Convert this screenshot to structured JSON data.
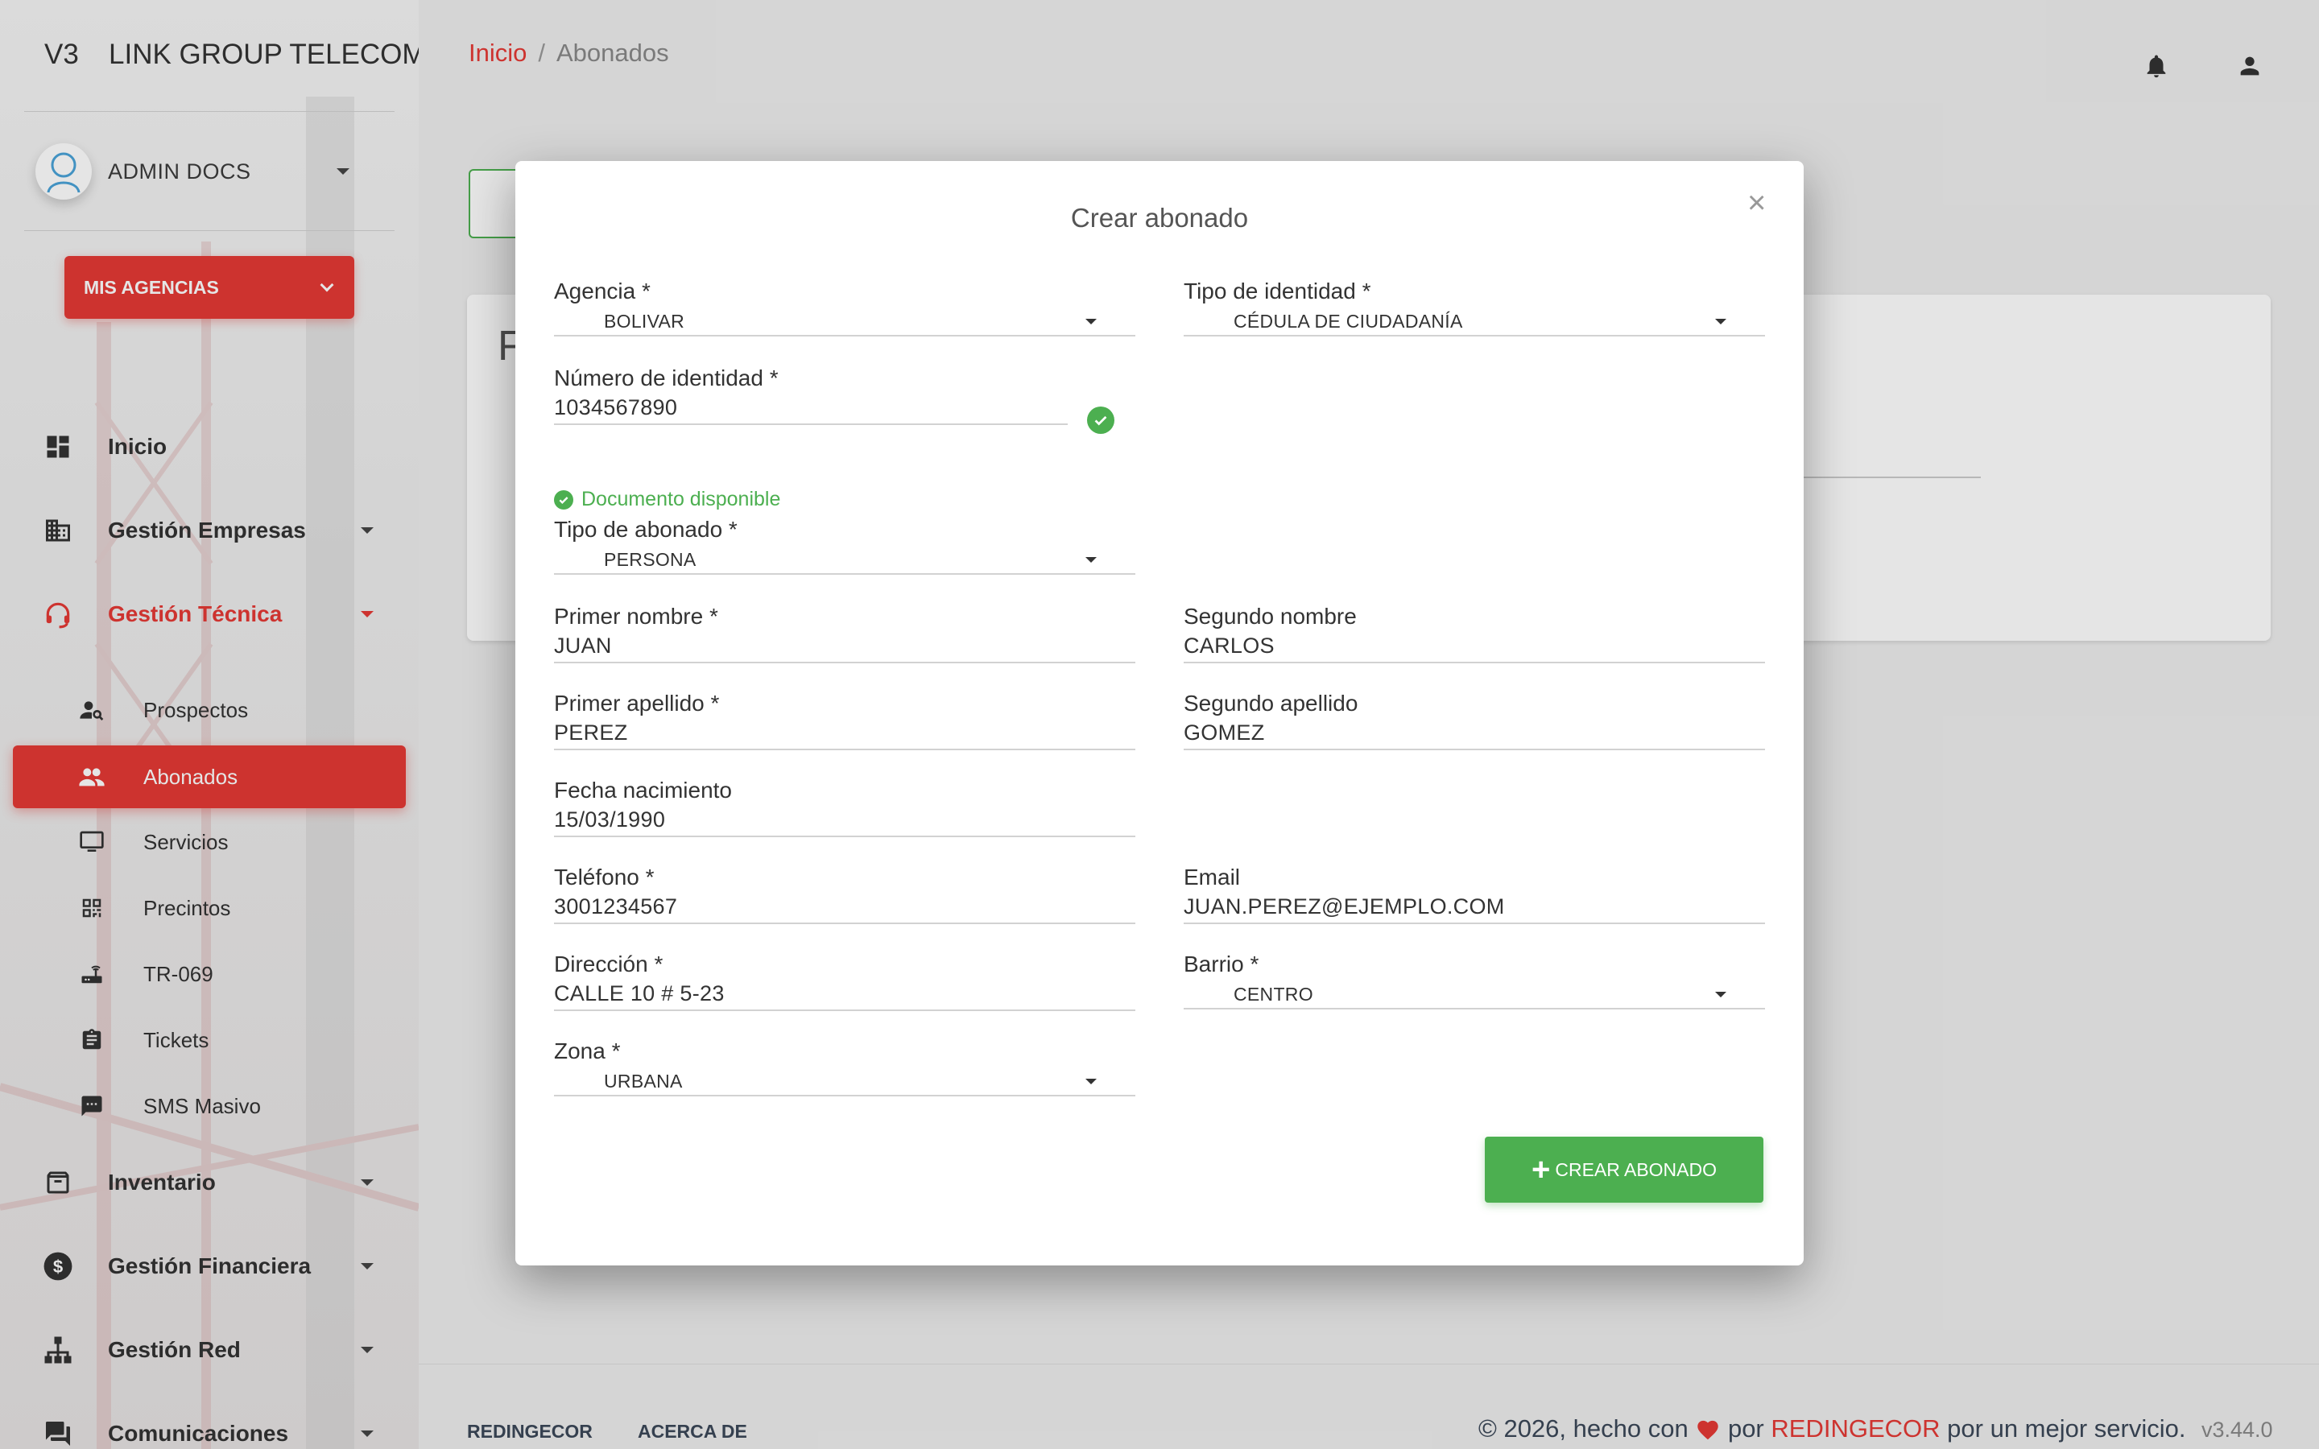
{
  "app": {
    "mini_logo": "V3",
    "title": "LINK GROUP TELECOMUNICACIONES"
  },
  "user": {
    "name": "ADMIN DOCS"
  },
  "agencies_button": {
    "label": "MIS AGENCIAS"
  },
  "sidebar": {
    "items": [
      {
        "label": "Inicio",
        "icon": "dashboard-icon"
      },
      {
        "label": "Gestión Empresas",
        "icon": "building-icon"
      },
      {
        "label": "Gestión Técnica",
        "icon": "support-agent-icon"
      },
      {
        "label": "Inventario",
        "icon": "archive-icon"
      },
      {
        "label": "Gestión Financiera",
        "icon": "dollar-icon"
      },
      {
        "label": "Gestión Red",
        "icon": "network-icon"
      },
      {
        "label": "Comunicaciones",
        "icon": "chat-icon"
      }
    ],
    "subitems": [
      {
        "label": "Prospectos",
        "icon": "person-search-icon"
      },
      {
        "label": "Abonados",
        "icon": "people-icon"
      },
      {
        "label": "Servicios",
        "icon": "monitor-icon"
      },
      {
        "label": "Precintos",
        "icon": "qr-code-icon"
      },
      {
        "label": "TR-069",
        "icon": "router-icon"
      },
      {
        "label": "Tickets",
        "icon": "clipboard-icon"
      },
      {
        "label": "SMS Masivo",
        "icon": "sms-icon"
      }
    ]
  },
  "breadcrumb": {
    "home": "Inicio",
    "sep": "/",
    "current": "Abonados"
  },
  "background": {
    "card_heading": "F"
  },
  "modal": {
    "title": "Crear abonado",
    "close": "×",
    "doc_status": "Documento disponible",
    "submit_label": "CREAR ABONADO",
    "fields": {
      "agencia": {
        "label": "Agencia *",
        "value": "BOLIVAR"
      },
      "tipo_identidad": {
        "label": "Tipo de identidad *",
        "value": "CÉDULA DE CIUDADANÍA"
      },
      "numero_identidad": {
        "label": "Número de identidad *",
        "value": "1034567890"
      },
      "tipo_abonado": {
        "label": "Tipo de abonado *",
        "value": "PERSONA"
      },
      "primer_nombre": {
        "label": "Primer nombre *",
        "value": "JUAN"
      },
      "segundo_nombre": {
        "label": "Segundo nombre",
        "value": "CARLOS"
      },
      "primer_apellido": {
        "label": "Primer apellido *",
        "value": "PEREZ"
      },
      "segundo_apellido": {
        "label": "Segundo apellido",
        "value": "GOMEZ"
      },
      "fecha_nacimiento": {
        "label": "Fecha nacimiento",
        "value": "15/03/1990"
      },
      "telefono": {
        "label": "Teléfono *",
        "value": "3001234567"
      },
      "email": {
        "label": "Email",
        "value": "JUAN.PEREZ@EJEMPLO.COM"
      },
      "direccion": {
        "label": "Dirección *",
        "value": "CALLE 10 # 5-23"
      },
      "barrio": {
        "label": "Barrio *",
        "value": "CENTRO"
      },
      "zona": {
        "label": "Zona *",
        "value": "URBANA"
      }
    }
  },
  "footer": {
    "links": [
      "REDINGECOR",
      "ACERCA DE"
    ],
    "copy_prefix": "© 2026, hecho con",
    "copy_by": "por",
    "brand": "REDINGECOR",
    "copy_suffix": "por un mejor servicio.",
    "version": "v3.44.0"
  },
  "colors": {
    "accent": "#e53935",
    "success": "#4caf50"
  }
}
